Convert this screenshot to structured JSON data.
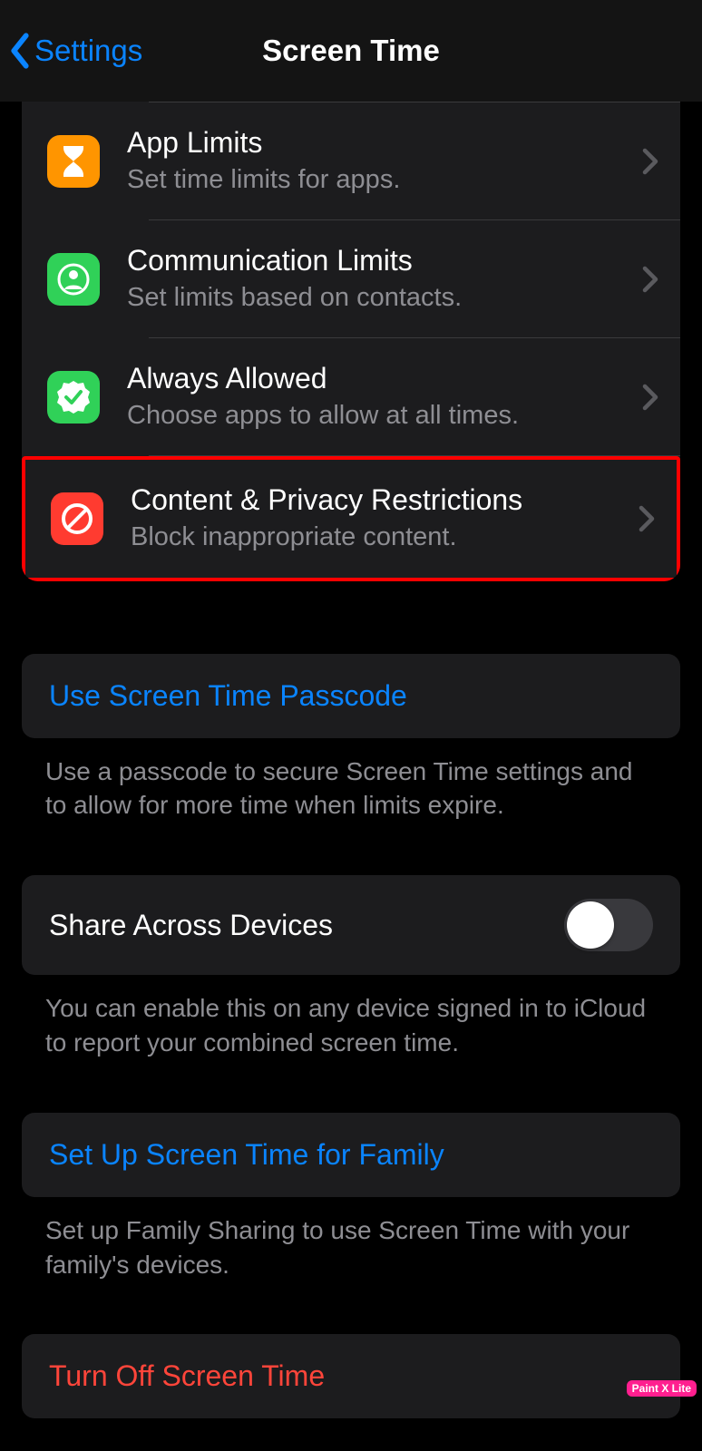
{
  "nav": {
    "back_label": "Settings",
    "title": "Screen Time"
  },
  "sections": {
    "app_limits": {
      "title": "App Limits",
      "sub": "Set time limits for apps."
    },
    "comm_limits": {
      "title": "Communication Limits",
      "sub": "Set limits based on contacts."
    },
    "always": {
      "title": "Always Allowed",
      "sub": "Choose apps to allow at all times."
    },
    "content": {
      "title": "Content & Privacy Restrictions",
      "sub": "Block inappropriate content."
    }
  },
  "passcode": {
    "action": "Use Screen Time Passcode",
    "footer": "Use a passcode to secure Screen Time settings and to allow for more time when limits expire."
  },
  "share": {
    "label": "Share Across Devices",
    "on": false,
    "footer": "You can enable this on any device signed in to iCloud to report your combined screen time."
  },
  "family": {
    "action": "Set Up Screen Time for Family",
    "footer": "Set up Family Sharing to use Screen Time with your family's devices."
  },
  "turnoff": {
    "action": "Turn Off Screen Time"
  },
  "watermark": "Paint X Lite"
}
